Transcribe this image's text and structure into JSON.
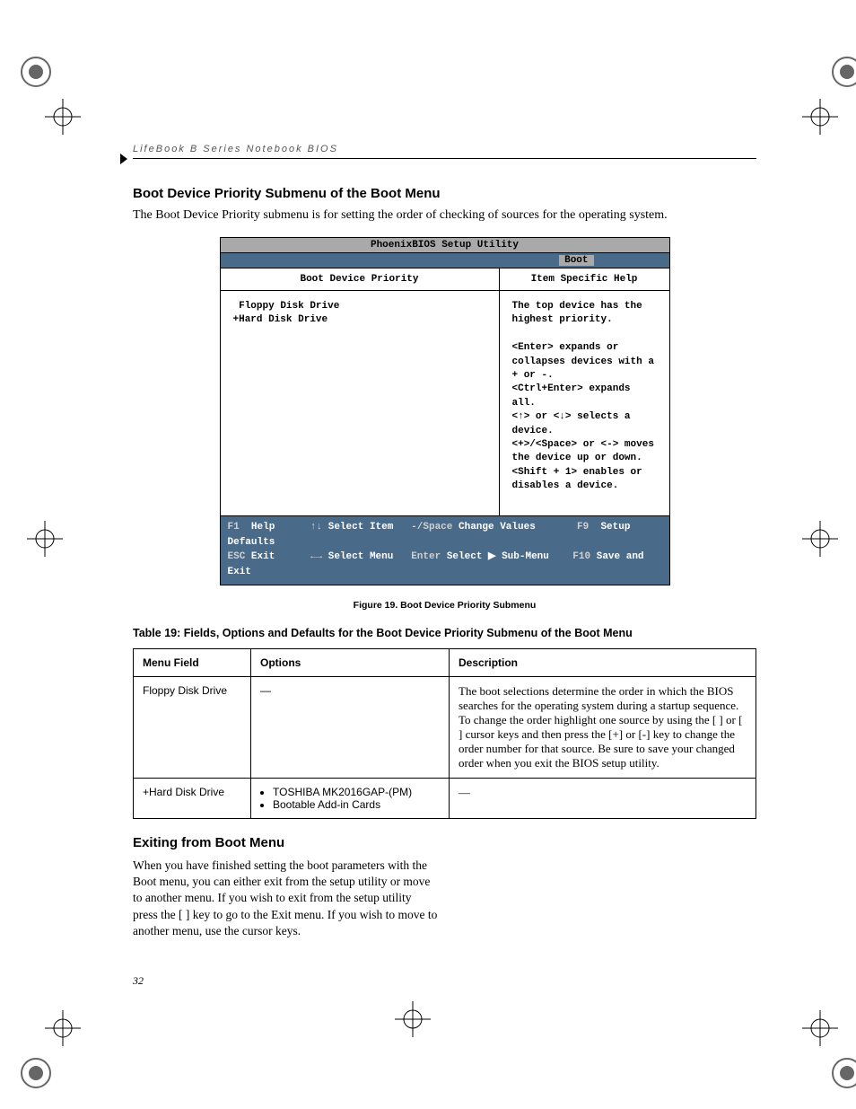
{
  "header": {
    "running": "LifeBook B Series Notebook BIOS"
  },
  "section1": {
    "title": "Boot Device Priority Submenu of the Boot Menu",
    "intro": "The Boot Device Priority submenu is for setting the order of checking of sources for the operating system."
  },
  "bios": {
    "title": "PhoenixBIOS Setup Utility",
    "tab": "Boot",
    "left_head": "Boot Device Priority",
    "right_head": "Item Specific Help",
    "devices": " Floppy Disk Drive\n+Hard Disk Drive",
    "help": "The top device has the highest priority.\n\n<Enter> expands or collapses devices with a + or -.\n<Ctrl+Enter> expands all.\n<↑> or <↓> selects a device.\n<+>/<Space> or <-> moves the device up or down.\n<Shift + 1> enables or disables a device.",
    "footer_line1_a": "F1",
    "footer_line1_b": "Help",
    "footer_line1_c": "↑↓",
    "footer_line1_d": "Select Item",
    "footer_line1_e": "-/Space",
    "footer_line1_f": "Change Values",
    "footer_line1_g": "F9",
    "footer_line1_h": "Setup Defaults",
    "footer_line2_a": "ESC",
    "footer_line2_b": "Exit",
    "footer_line2_c": "←→",
    "footer_line2_d": "Select Menu",
    "footer_line2_e": "Enter",
    "footer_line2_f": "Select ▶ Sub-Menu",
    "footer_line2_g": "F10",
    "footer_line2_h": "Save and Exit"
  },
  "figcaption": "Figure 19.  Boot Device Priority Submenu",
  "table": {
    "title": "Table 19: Fields, Options and Defaults for the Boot Device Priority Submenu of the Boot Menu",
    "headers": {
      "c1": "Menu Field",
      "c2": "Options",
      "c3": "Description"
    },
    "rows": [
      {
        "field": "Floppy Disk Drive",
        "options_dash": "—",
        "desc": "The boot selections determine the order in which the BIOS searches for the operating system during a startup sequence. To change the order highlight one source by using the [   ] or [   ] cursor keys and then press the [+] or [-] key to change the order number for that source. Be sure to save your changed order when you exit the BIOS setup utility."
      },
      {
        "field": "+Hard Disk Drive",
        "options": [
          "TOSHIBA MK2016GAP-(PM)",
          "Bootable Add-in Cards"
        ],
        "desc_dash": "—"
      }
    ]
  },
  "section2": {
    "title": "Exiting from Boot Menu",
    "body": "When you have finished setting the boot parameters with the Boot menu, you can either exit from the setup utility or move to another menu. If you wish to exit from the setup utility press the [     ] key to go to the Exit menu. If you wish to move to another menu, use the cursor keys."
  },
  "page_number": "32"
}
